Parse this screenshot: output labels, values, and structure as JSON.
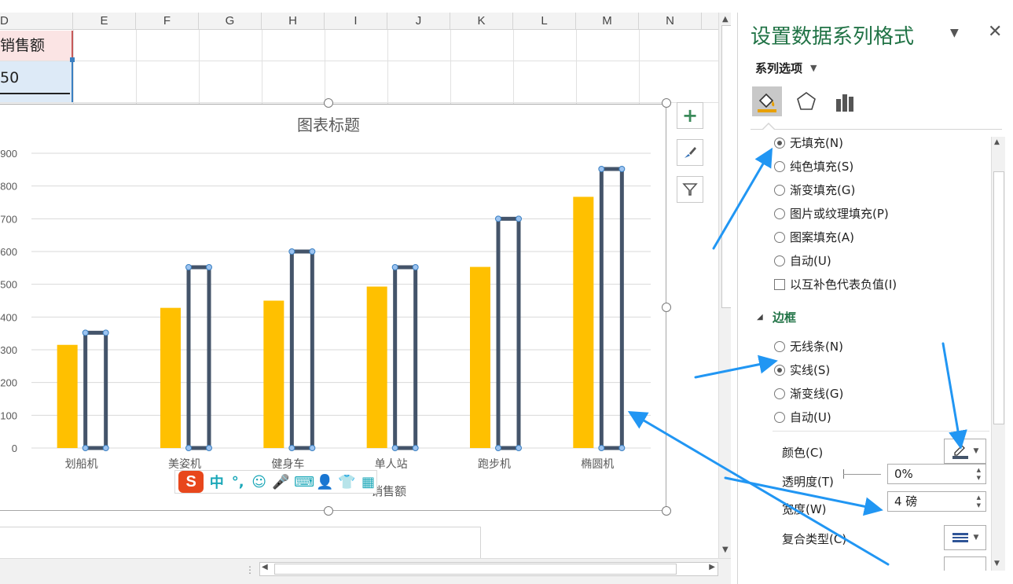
{
  "sheet": {
    "columns": [
      "D",
      "E",
      "F",
      "G",
      "H",
      "I",
      "J",
      "K",
      "L",
      "M",
      "N"
    ],
    "cell_d1": "销售额",
    "cell_d2": "50"
  },
  "chart": {
    "toolbar": {
      "add_element_label": "+"
    }
  },
  "chart_data": {
    "type": "bar",
    "title": "图表标题",
    "categories": [
      "划船机",
      "美姿机",
      "健身车",
      "单人站",
      "跑步机",
      "椭圆机"
    ],
    "series": [
      {
        "values": [
          315,
          428,
          450,
          493,
          553,
          767
        ],
        "color": "#ffc000"
      },
      {
        "name": "销售额",
        "values": [
          352,
          552,
          600,
          552,
          700,
          852
        ],
        "color": "#44546a"
      }
    ],
    "y_tick_labels": [
      "0",
      "100",
      "200",
      "300",
      "400",
      "500",
      "600",
      "700",
      "800",
      "900"
    ],
    "ylim": [
      0,
      900
    ],
    "grid": true,
    "legend_position": "bottom"
  },
  "legend": {
    "series2_label": "销售额"
  },
  "ime": {
    "logo": "S",
    "items": [
      "中",
      "°,",
      "☺",
      "🎤",
      "⌨",
      "👤",
      "👕",
      "▦"
    ]
  },
  "pane": {
    "title": "设置数据系列格式",
    "series_options": "系列选项",
    "fill_options": [
      "无填充(N)",
      "纯色填充(S)",
      "渐变填充(G)",
      "图片或纹理填充(P)",
      "图案填充(A)",
      "自动(U)"
    ],
    "invert_if_negative": "以互补色代表负值(I)",
    "border_section": "边框",
    "border_options": [
      "无线条(N)",
      "实线(S)",
      "渐变线(G)",
      "自动(U)"
    ],
    "color_label": "颜色(C)",
    "transparency_label": "透明度(T)",
    "transparency_value": "0%",
    "width_label": "宽度(W)",
    "width_value": "4 磅",
    "compound_label": "复合类型(C)",
    "selected_fill": 0,
    "selected_border": 1,
    "accent_color": "#217346"
  }
}
